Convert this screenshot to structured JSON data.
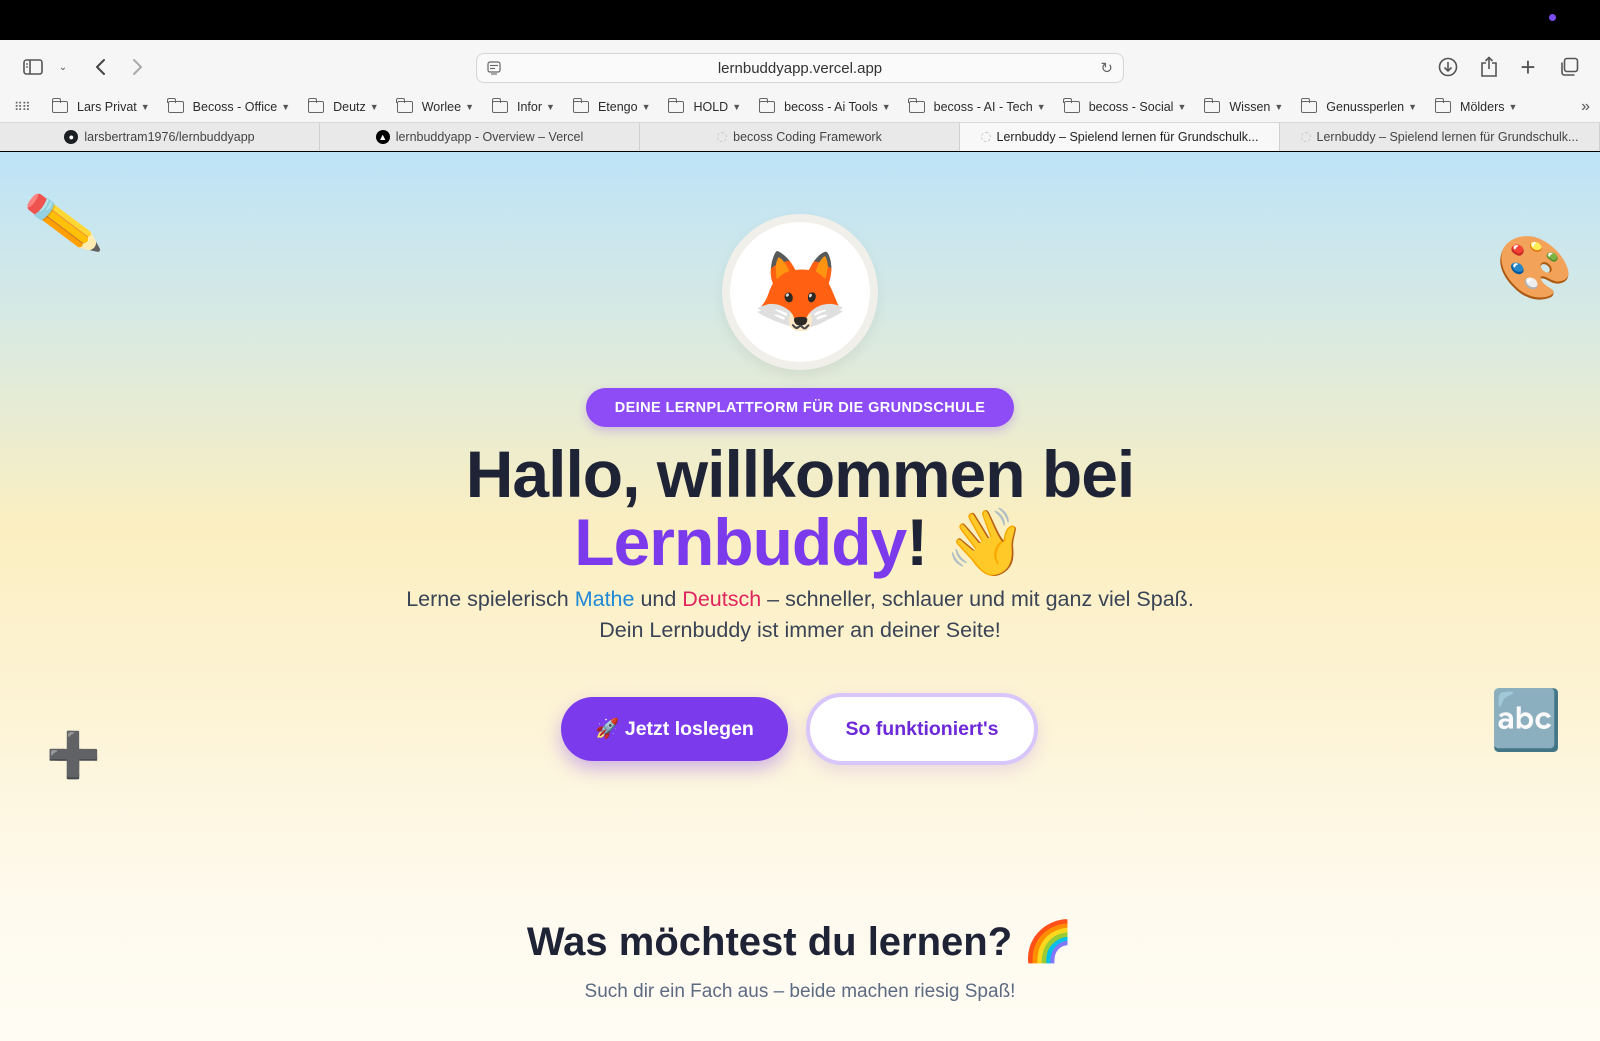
{
  "browser": {
    "url": "lernbuddyapp.vercel.app",
    "bookmarks": [
      {
        "label": "Lars Privat"
      },
      {
        "label": "Becoss - Office"
      },
      {
        "label": "Deutz"
      },
      {
        "label": "Worlee"
      },
      {
        "label": "Infor"
      },
      {
        "label": "Etengo"
      },
      {
        "label": "HOLD"
      },
      {
        "label": "becoss - Ai Tools"
      },
      {
        "label": "becoss - AI - Tech"
      },
      {
        "label": "becoss - Social"
      },
      {
        "label": "Wissen"
      },
      {
        "label": "Genussperlen"
      },
      {
        "label": "Mölders"
      }
    ],
    "tabs": [
      {
        "label": "larsbertram1976/lernbuddyapp",
        "icon": "github-icon"
      },
      {
        "label": "lernbuddyapp - Overview – Vercel",
        "icon": "vercel-icon"
      },
      {
        "label": "becoss Coding Framework",
        "icon": "blank-page-icon"
      },
      {
        "label": "Lernbuddy – Spielend lernen für Grundschulk...",
        "icon": "blank-page-icon",
        "active": true
      },
      {
        "label": "Lernbuddy – Spielend lernen für Grundschulk...",
        "icon": "blank-page-icon"
      }
    ]
  },
  "hero": {
    "mascot": "🦊",
    "badge": "DEINE LERNPLATTFORM FÜR DIE GRUNDSCHULE",
    "title_line1": "Hallo, willkommen bei",
    "title_brand": "Lernbuddy",
    "title_suffix": "! 👋",
    "lead_part1": "Lerne spielerisch ",
    "lead_mathe": "Mathe",
    "lead_part2": " und ",
    "lead_deutsch": "Deutsch",
    "lead_part3": " – schneller, schlauer und mit ganz viel Spaß. Dein Lernbuddy ist immer an deiner Seite!",
    "cta_primary": "🚀 Jetzt loslegen",
    "cta_secondary": "So funktioniert's"
  },
  "decorations": {
    "pencil": "✏️",
    "palette": "🎨",
    "plus": "➕",
    "abc": "🔤"
  },
  "subjects": {
    "title": "Was möchtest du lernen? 🌈",
    "subtitle": "Such dir ein Fach aus – beide machen riesig Spaß!"
  },
  "colors": {
    "brand": "#7c3aed",
    "badge": "#8e4cf6",
    "mathe": "#1e88d6",
    "deutsch": "#e0245e",
    "heading": "#1e2336"
  }
}
